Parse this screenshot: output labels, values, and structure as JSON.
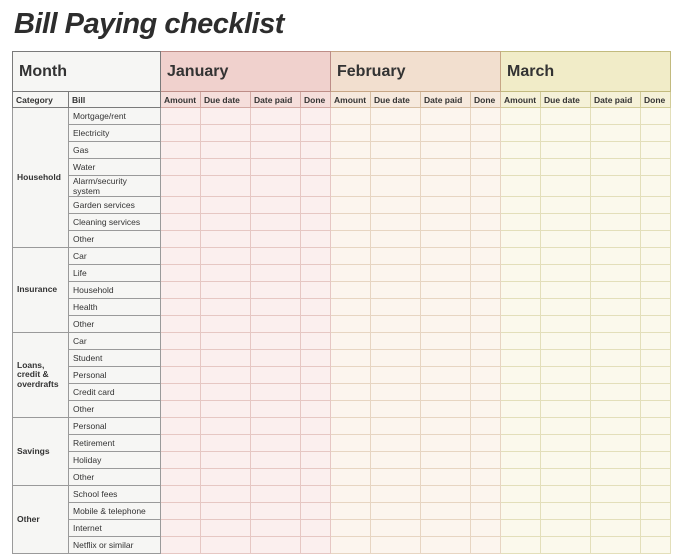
{
  "title": "Bill Paying checklist",
  "header": {
    "month_label": "Month",
    "months": [
      "January",
      "February",
      "March"
    ],
    "category_label": "Category",
    "bill_label": "Bill",
    "month_columns": [
      "Amount",
      "Due date",
      "Date paid",
      "Done"
    ]
  },
  "categories": [
    {
      "name": "Household",
      "bills": [
        "Mortgage/rent",
        "Electricity",
        "Gas",
        "Water",
        "Alarm/security system",
        "Garden services",
        "Cleaning services",
        "Other"
      ]
    },
    {
      "name": "Insurance",
      "bills": [
        "Car",
        "Life",
        "Household",
        "Health",
        "Other"
      ]
    },
    {
      "name": "Loans, credit & overdrafts",
      "bills": [
        "Car",
        "Student",
        "Personal",
        "Credit card",
        "Other"
      ]
    },
    {
      "name": "Savings",
      "bills": [
        "Personal",
        "Retirement",
        "Holiday",
        "Other"
      ]
    },
    {
      "name": "Other",
      "bills": [
        "School fees",
        "Mobile & telephone",
        "Internet",
        "Netflix or similar"
      ]
    }
  ],
  "month_styles": [
    "jan",
    "feb",
    "mar"
  ]
}
